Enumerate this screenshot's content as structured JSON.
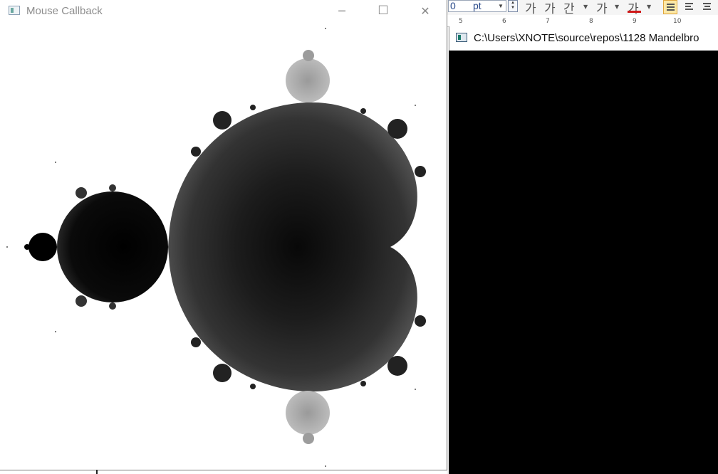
{
  "mouse_window": {
    "title": "Mouse Callback",
    "controls": {
      "minimize": "─",
      "maximize": "☐",
      "close": "✕"
    }
  },
  "console_window": {
    "title": "C:\\Users\\XNOTE\\source\\repos\\1128 Mandelbro"
  },
  "word_toolbar": {
    "font_size_value": "0",
    "font_size_unit": "pt",
    "buttons": [
      "가",
      "가",
      "간",
      "가",
      "가"
    ],
    "ruler_numbers": [
      "5",
      "6",
      "7",
      "8",
      "9",
      "10"
    ]
  },
  "colors": {
    "fractal_interior_center": "#000000",
    "fractal_edge_gray": "#a8a8a8",
    "console_background": "#000000",
    "font_color_underline": "#d01818"
  }
}
